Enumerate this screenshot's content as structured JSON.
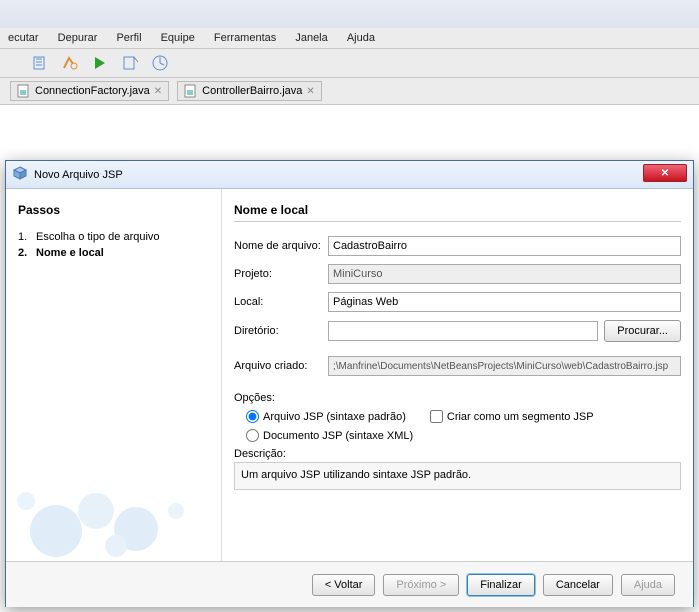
{
  "menu": {
    "items": [
      "ecutar",
      "Depurar",
      "Perfil",
      "Equipe",
      "Ferramentas",
      "Janela",
      "Ajuda"
    ]
  },
  "tabs": [
    {
      "label": "ConnectionFactory.java"
    },
    {
      "label": "ControllerBairro.java"
    }
  ],
  "dialog": {
    "title": "Novo Arquivo JSP",
    "steps": {
      "heading": "Passos",
      "items": [
        {
          "n": "1.",
          "label": "Escolha o tipo de arquivo",
          "current": false
        },
        {
          "n": "2.",
          "label": "Nome e local",
          "current": true
        }
      ]
    },
    "rightHeading": "Nome e local",
    "form": {
      "filenameLabel": "Nome de arquivo:",
      "filenameValue": "CadastroBairro",
      "projectLabel": "Projeto:",
      "projectValue": "MiniCurso",
      "localLabel": "Local:",
      "localValue": "Páginas Web",
      "dirLabel": "Diretório:",
      "dirValue": "",
      "browseBtn": "Procurar...",
      "createdLabel": "Arquivo criado:",
      "createdValue": ";\\Manfrine\\Documents\\NetBeansProjects\\MiniCurso\\web\\CadastroBairro.jsp"
    },
    "options": {
      "heading": "Opções:",
      "radio1": "Arquivo JSP (sintaxe padrão)",
      "check1": "Criar como um segmento JSP",
      "radio2": "Documento JSP (sintaxe XML)",
      "descLabel": "Descrição:",
      "descText": "Um arquivo JSP utilizando sintaxe JSP padrão."
    },
    "buttons": {
      "back": "< Voltar",
      "next": "Próximo >",
      "finish": "Finalizar",
      "cancel": "Cancelar",
      "help": "Ajuda"
    }
  }
}
